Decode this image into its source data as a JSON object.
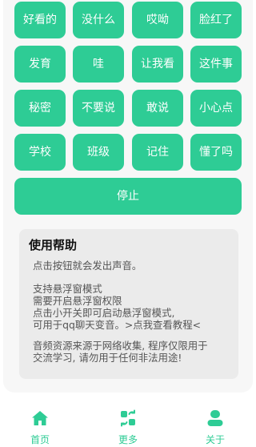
{
  "sound_buttons": [
    "好看的",
    "没什么",
    "哎呦",
    "脸红了",
    "发育",
    "哇",
    "让我看",
    "这件事",
    "秘密",
    "不要说",
    "敢说",
    "小心点",
    "学校",
    "班级",
    "记住",
    "懂了吗"
  ],
  "stop_button": "停止",
  "help": {
    "title": "使用帮助",
    "line1": "点击按钮就会发出声音。",
    "line2": "支持悬浮窗模式",
    "line3": "需要开启悬浮窗权限",
    "line4": "点击小开关即可启动悬浮窗模式,",
    "line5_text": "可用于qq聊天变音。",
    "line5_link": ">点我查看教程<",
    "line6": "音频资源来源于网络收集, 程序仅限用于",
    "line7": "交流学习, 请勿用于任何非法用途!"
  },
  "tabs": {
    "home": "首页",
    "more": "更多",
    "about": "关于"
  },
  "colors": {
    "accent": "#2ecc95",
    "help_bg": "#ebebeb",
    "card_bg": "#f7f7f7"
  },
  "icons": {
    "home": "home-icon",
    "more": "more-apps-icon",
    "about": "user-icon"
  }
}
